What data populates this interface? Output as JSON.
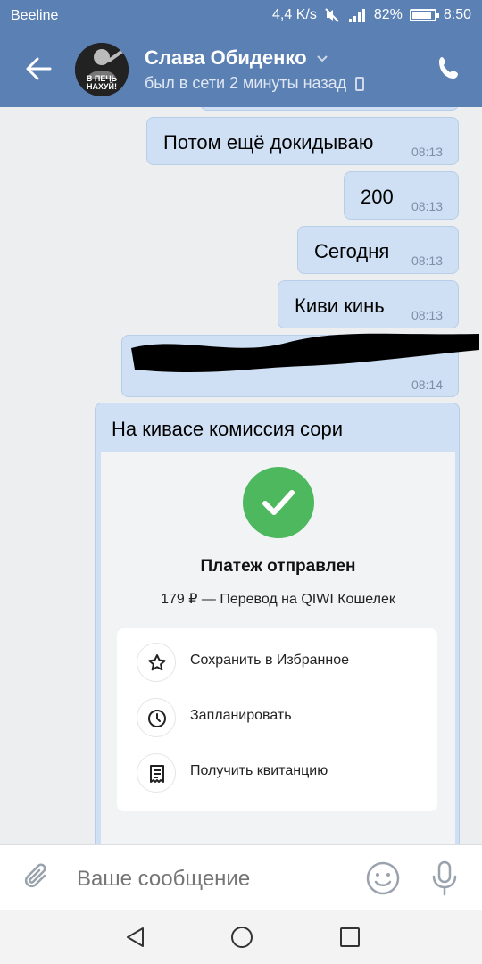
{
  "statusbar": {
    "carrier": "Beeline",
    "speed": "4,4 K/s",
    "battery_pct": "82%",
    "clock": "8:50"
  },
  "header": {
    "contact_name": "Слава Обиденко",
    "last_seen": "был в сети 2 минуты назад",
    "avatar_caption_1": "В ПЕЧЬ",
    "avatar_caption_2": "НАХУЙ!"
  },
  "messages": [
    {
      "text": "Потом ещё докидываю",
      "time": "08:13"
    },
    {
      "text": "200",
      "time": "08:13"
    },
    {
      "text": "Сегодня",
      "time": "08:13"
    },
    {
      "text": "Киви кинь",
      "time": "08:13"
    },
    {
      "text": "",
      "time": "08:14",
      "redacted": true
    }
  ],
  "card": {
    "caption": "На кивасе комиссия сори",
    "title": "Платеж отправлен",
    "subtitle": "179 ₽ — Перевод на QIWI Кошелек",
    "actions": [
      {
        "label": "Сохранить в Избранное",
        "icon": "star-icon"
      },
      {
        "label": "Запланировать",
        "icon": "clock-icon"
      },
      {
        "label": "Получить квитанцию",
        "icon": "receipt-icon"
      }
    ]
  },
  "composer": {
    "placeholder": "Ваше сообщение"
  },
  "colors": {
    "header": "#5b80b4",
    "bubble": "#cfe0f4",
    "success": "#4db85d"
  }
}
